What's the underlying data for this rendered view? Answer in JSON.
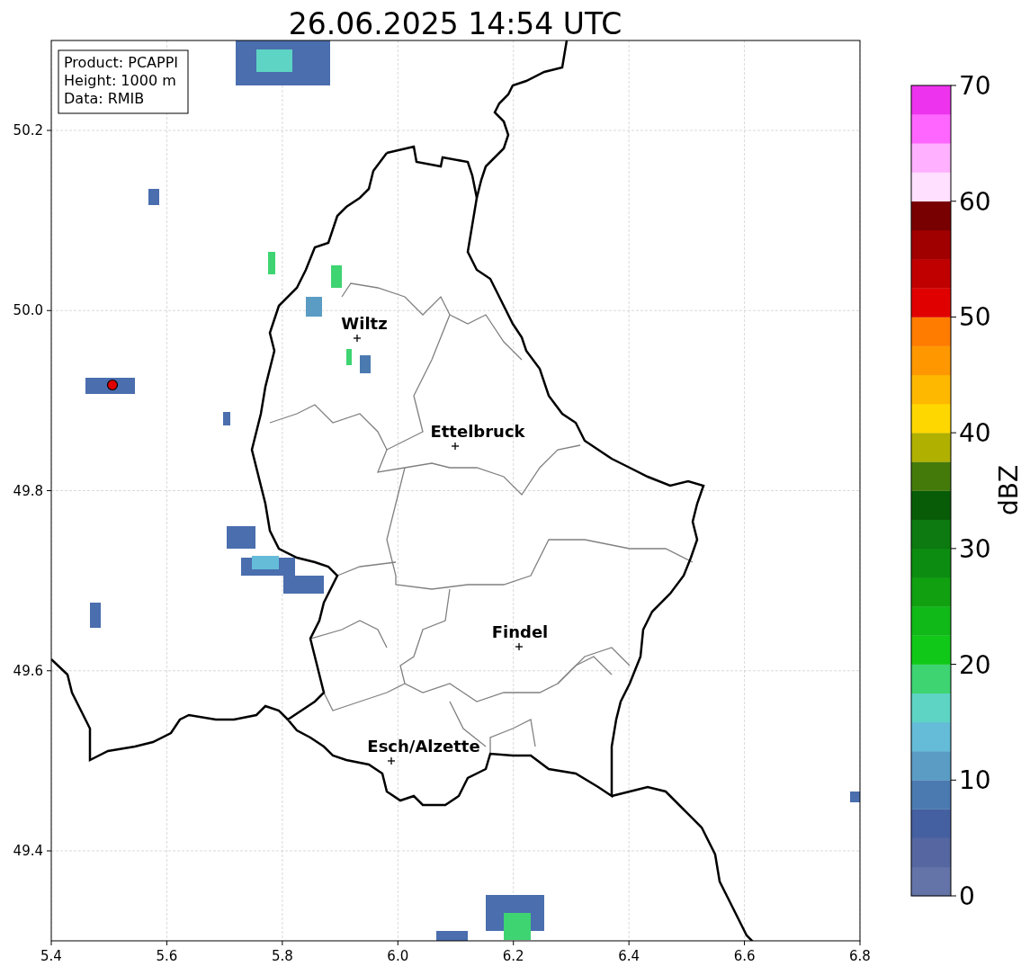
{
  "title": "26.06.2025 14:54 UTC",
  "info_box": [
    "Product: PCAPPI",
    "Height: 1000 m",
    "Data: RMIB"
  ],
  "cities": [
    {
      "name": "Wiltz"
    },
    {
      "name": "Ettelbruck"
    },
    {
      "name": "Findel"
    },
    {
      "name": "Esch/Alzette"
    }
  ],
  "x_ticks": [
    "5.4",
    "5.6",
    "5.8",
    "6.0",
    "6.2",
    "6.4",
    "6.6",
    "6.8"
  ],
  "y_ticks": [
    "50.2",
    "50.0",
    "49.8",
    "49.6",
    "49.4"
  ],
  "colorbar": {
    "label": "dBZ",
    "ticks": [
      "70",
      "60",
      "50",
      "40",
      "30",
      "20",
      "10",
      "0"
    ],
    "bands": [
      {
        "color": "#6474a8"
      },
      {
        "color": "#5566a0"
      },
      {
        "color": "#4560a0"
      },
      {
        "color": "#4a7ab0"
      },
      {
        "color": "#5a9cc4"
      },
      {
        "color": "#64bcd8"
      },
      {
        "color": "#5ed4c4"
      },
      {
        "color": "#3ed472"
      },
      {
        "color": "#10c818"
      },
      {
        "color": "#10b818"
      },
      {
        "color": "#10a010"
      },
      {
        "color": "#0c8c10"
      },
      {
        "color": "#0c7a10"
      },
      {
        "color": "#085c08"
      },
      {
        "color": "#447a0a"
      },
      {
        "color": "#b0b000"
      },
      {
        "color": "#ffd700"
      },
      {
        "color": "#ffb800"
      },
      {
        "color": "#ff9800"
      },
      {
        "color": "#ff7c00"
      },
      {
        "color": "#e00000"
      },
      {
        "color": "#c00000"
      },
      {
        "color": "#a00000"
      },
      {
        "color": "#780000"
      },
      {
        "color": "#ffe0ff"
      },
      {
        "color": "#ffb0ff"
      },
      {
        "color": "#ff66ff"
      },
      {
        "color": "#ee33ee"
      }
    ]
  }
}
